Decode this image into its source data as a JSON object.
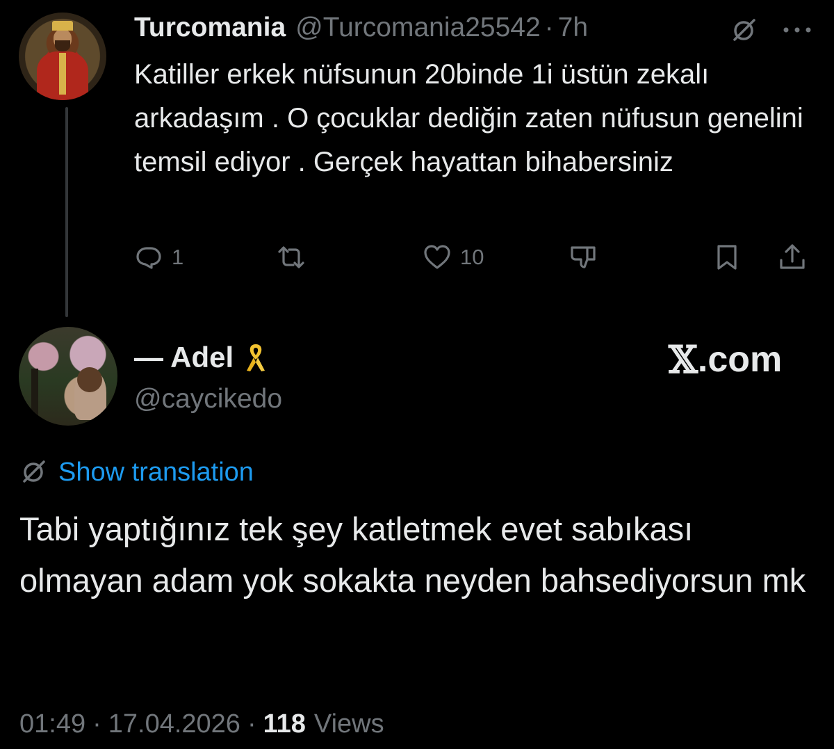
{
  "parent_tweet": {
    "display_name": "Turcomania",
    "handle": "@Turcomania25542",
    "separator": "·",
    "time": "7h",
    "text": "Katiller erkek nüfsunun 20binde 1i üstün zekalı arkadaşım . O çocuklar dediğin zaten nüfusun genelini temsil ediyor . Gerçek hayattan bihabersiniz",
    "actions": {
      "reply_count": "1",
      "repost_count": "",
      "like_count": "10"
    }
  },
  "reply_tweet": {
    "display_name": "— Adel",
    "name_emoji": "yellow-ribbon",
    "handle": "@caycikedo",
    "watermark_logo": "𝕏",
    "watermark_text": ".com",
    "show_translation": "Show translation",
    "text": "Tabi yaptığınız tek şey katletmek evet sabıkası olmayan adam yok sokakta neyden bahsediyorsun mk",
    "meta": {
      "time": "01:49",
      "separator": "·",
      "date": "17.04.2026",
      "views_count": "118",
      "views_label": "Views"
    }
  },
  "colors": {
    "background": "#000000",
    "primary_text": "#e7e9ea",
    "secondary_text": "#71767b",
    "link": "#1d9bf0",
    "thread_line": "#333639"
  }
}
